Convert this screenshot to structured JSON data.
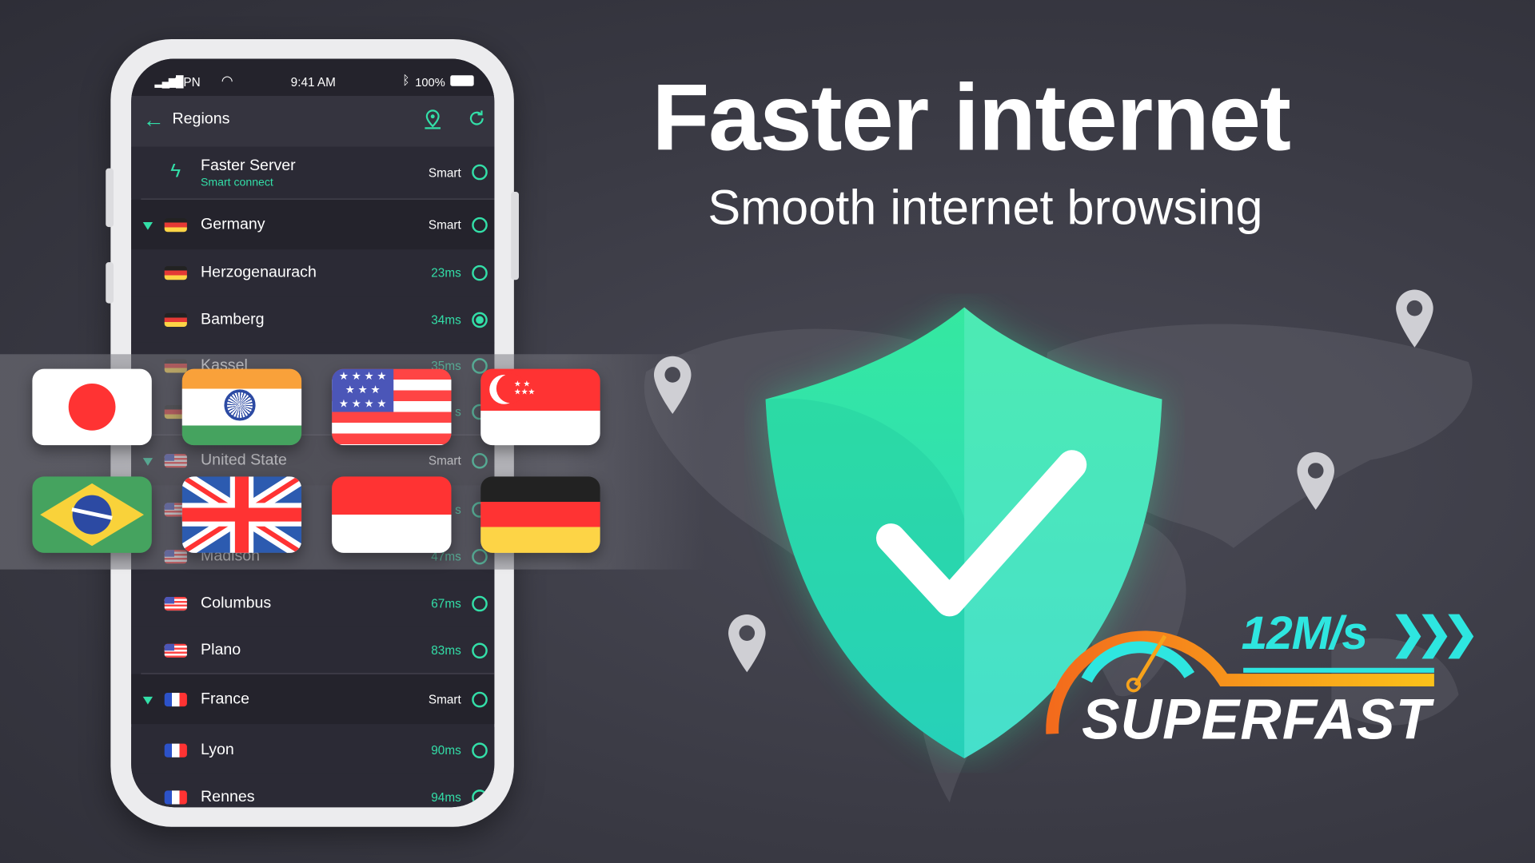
{
  "status_bar": {
    "carrier": "VPN",
    "time": "9:41 AM",
    "battery": "100%"
  },
  "header": {
    "title": "Regions",
    "icons": [
      "back-arrow-icon",
      "map-pin-icon",
      "refresh-icon"
    ]
  },
  "faster_server": {
    "title": "Faster Server",
    "subtitle": "Smart connect",
    "badge": "Smart"
  },
  "regions": [
    {
      "type": "country",
      "name": "Germany",
      "flag": "de",
      "value": "Smart",
      "selected": false
    },
    {
      "type": "city",
      "name": "Herzogenaurach",
      "flag": "de",
      "value": "23ms",
      "selected": false
    },
    {
      "type": "city",
      "name": "Bamberg",
      "flag": "de",
      "value": "34ms",
      "selected": true
    },
    {
      "type": "city",
      "name": "Kassel",
      "flag": "de",
      "value": "35ms",
      "selected": false
    },
    {
      "type": "city",
      "name": "",
      "flag": "de",
      "value": "s",
      "selected": false
    },
    {
      "type": "country",
      "name": "United State",
      "flag": "us",
      "value": "Smart",
      "selected": false
    },
    {
      "type": "city",
      "name": "",
      "flag": "us",
      "value": "s",
      "selected": false
    },
    {
      "type": "city",
      "name": "Madison",
      "flag": "us",
      "value": "47ms",
      "selected": false
    },
    {
      "type": "city",
      "name": "Columbus",
      "flag": "us",
      "value": "67ms",
      "selected": false
    },
    {
      "type": "city",
      "name": "Plano",
      "flag": "us",
      "value": "83ms",
      "selected": false
    },
    {
      "type": "country",
      "name": "France",
      "flag": "fr",
      "value": "Smart",
      "selected": false
    },
    {
      "type": "city",
      "name": "Lyon",
      "flag": "fr",
      "value": "90ms",
      "selected": false
    },
    {
      "type": "city",
      "name": "Rennes",
      "flag": "fr",
      "value": "94ms",
      "selected": false
    }
  ],
  "flag_tiles": [
    "Japan",
    "India",
    "United States",
    "Singapore",
    "Brazil",
    "United Kingdom",
    "Indonesia",
    "Germany"
  ],
  "hero": {
    "title": "Faster internet",
    "subtitle": "Smooth internet browsing"
  },
  "badge": {
    "speed": "12M/s",
    "label": "SUPERFAST"
  },
  "colors": {
    "accent": "#33dfa8",
    "background": "#3b3b45",
    "badge_orange": "#f7a21b",
    "badge_cyan": "#2ee6e0"
  }
}
